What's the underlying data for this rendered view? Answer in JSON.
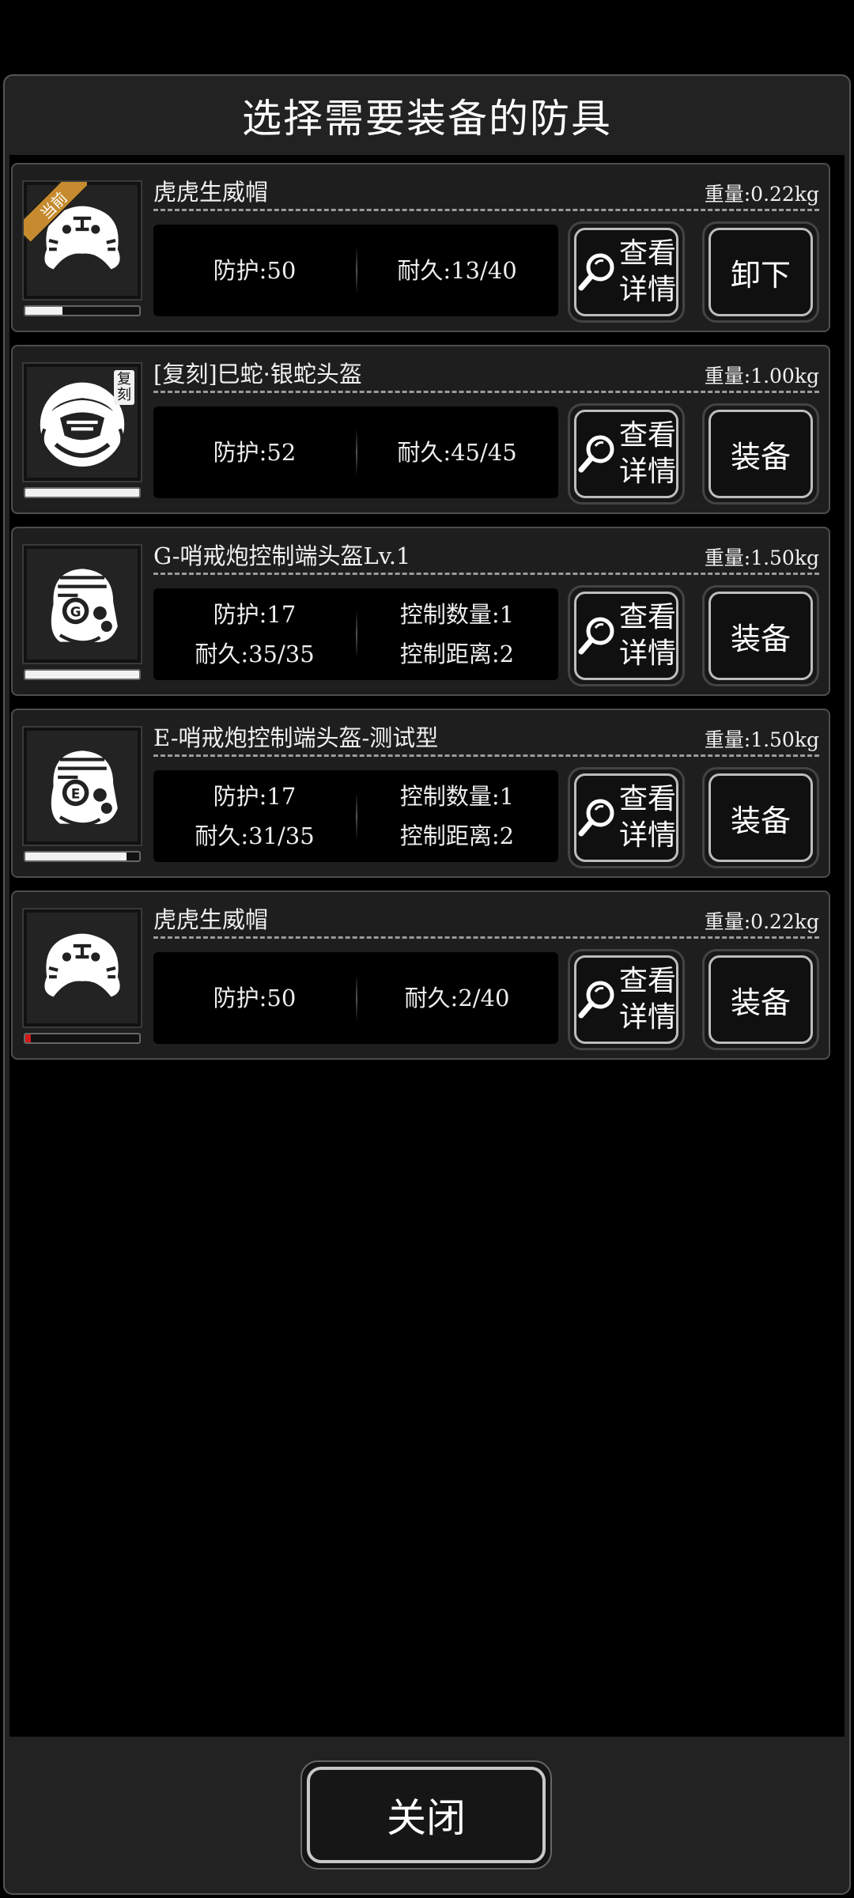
{
  "dialog": {
    "title": "选择需要装备的防具",
    "close_label": "关闭"
  },
  "items": [
    {
      "name": "虎虎生威帽",
      "weight": "重量:0.22kg",
      "icon": "tiger-hat-icon",
      "tag": "当前",
      "durability_fraction": 0.325,
      "stats_left": [
        "防护:50"
      ],
      "stats_right": [
        "耐久:13/40"
      ],
      "detail_label": [
        "查看",
        "详情"
      ],
      "action_label": "卸下"
    },
    {
      "name": "[复刻]巳蛇·银蛇头盔",
      "weight": "重量:1.00kg",
      "icon": "snake-helmet-icon",
      "tag": "复刻",
      "durability_fraction": 1.0,
      "stats_left": [
        "防护:52"
      ],
      "stats_right": [
        "耐久:45/45"
      ],
      "detail_label": [
        "查看",
        "详情"
      ],
      "action_label": "装备"
    },
    {
      "name": "G-哨戒炮控制端头盔Lv.1",
      "weight": "重量:1.50kg",
      "icon": "sentry-helmet-g-icon",
      "durability_fraction": 1.0,
      "stats_left": [
        "防护:17",
        "耐久:35/35"
      ],
      "stats_right": [
        "控制数量:1",
        "控制距离:2"
      ],
      "detail_label": [
        "查看",
        "详情"
      ],
      "action_label": "装备"
    },
    {
      "name": "E-哨戒炮控制端头盔-测试型",
      "weight": "重量:1.50kg",
      "icon": "sentry-helmet-e-icon",
      "durability_fraction": 0.886,
      "stats_left": [
        "防护:17",
        "耐久:31/35"
      ],
      "stats_right": [
        "控制数量:1",
        "控制距离:2"
      ],
      "detail_label": [
        "查看",
        "详情"
      ],
      "action_label": "装备"
    },
    {
      "name": "虎虎生威帽",
      "weight": "重量:0.22kg",
      "icon": "tiger-hat-icon",
      "durability_fraction": 0.05,
      "stats_left": [
        "防护:50"
      ],
      "stats_right": [
        "耐久:2/40"
      ],
      "detail_label": [
        "查看",
        "详情"
      ],
      "action_label": "装备"
    }
  ]
}
